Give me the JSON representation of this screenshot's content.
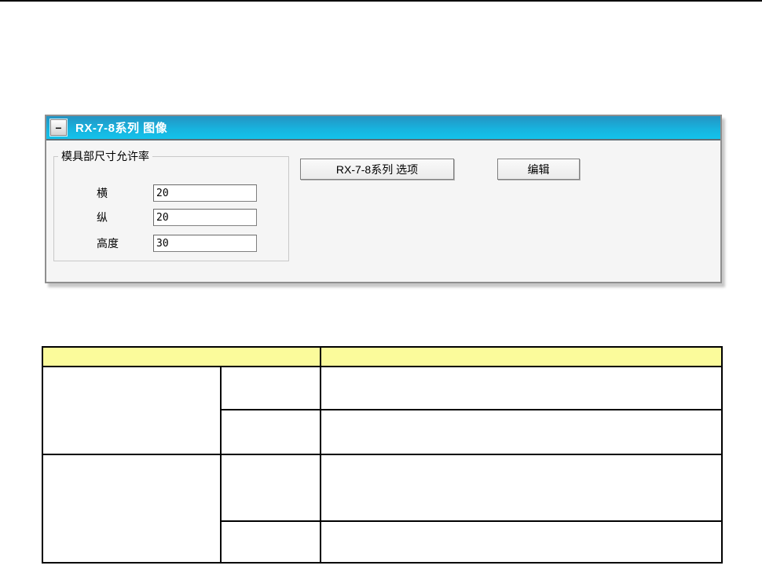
{
  "page": {
    "background_color": "#ffffff",
    "top_rule_color": "#000000"
  },
  "panel": {
    "title": "RX-7-8系列 图像",
    "minimize_glyph": "−",
    "titlebar_gradient_top": "#2493c3",
    "titlebar_gradient_bottom": "#13c3ec",
    "body_background": "#f5f5f5",
    "groupbox": {
      "title": "模具部尺寸允许率",
      "fields": [
        {
          "label": "横",
          "value": "20"
        },
        {
          "label": "纵",
          "value": "20"
        },
        {
          "label": "高度",
          "value": "30"
        }
      ]
    },
    "buttons": {
      "options_label": "RX-7-8系列 选项",
      "edit_label": "编辑"
    }
  },
  "table": {
    "header_background": "#fbfb9b",
    "border_color": "#000000",
    "header": [
      "",
      ""
    ],
    "groups": [
      {
        "col1": "",
        "rows": [
          {
            "col2": "",
            "col3": ""
          },
          {
            "col2": "",
            "col3": ""
          }
        ]
      },
      {
        "col1": "",
        "rows": [
          {
            "col2": "",
            "col3": ""
          },
          {
            "col2": "",
            "col3": ""
          }
        ]
      }
    ]
  }
}
